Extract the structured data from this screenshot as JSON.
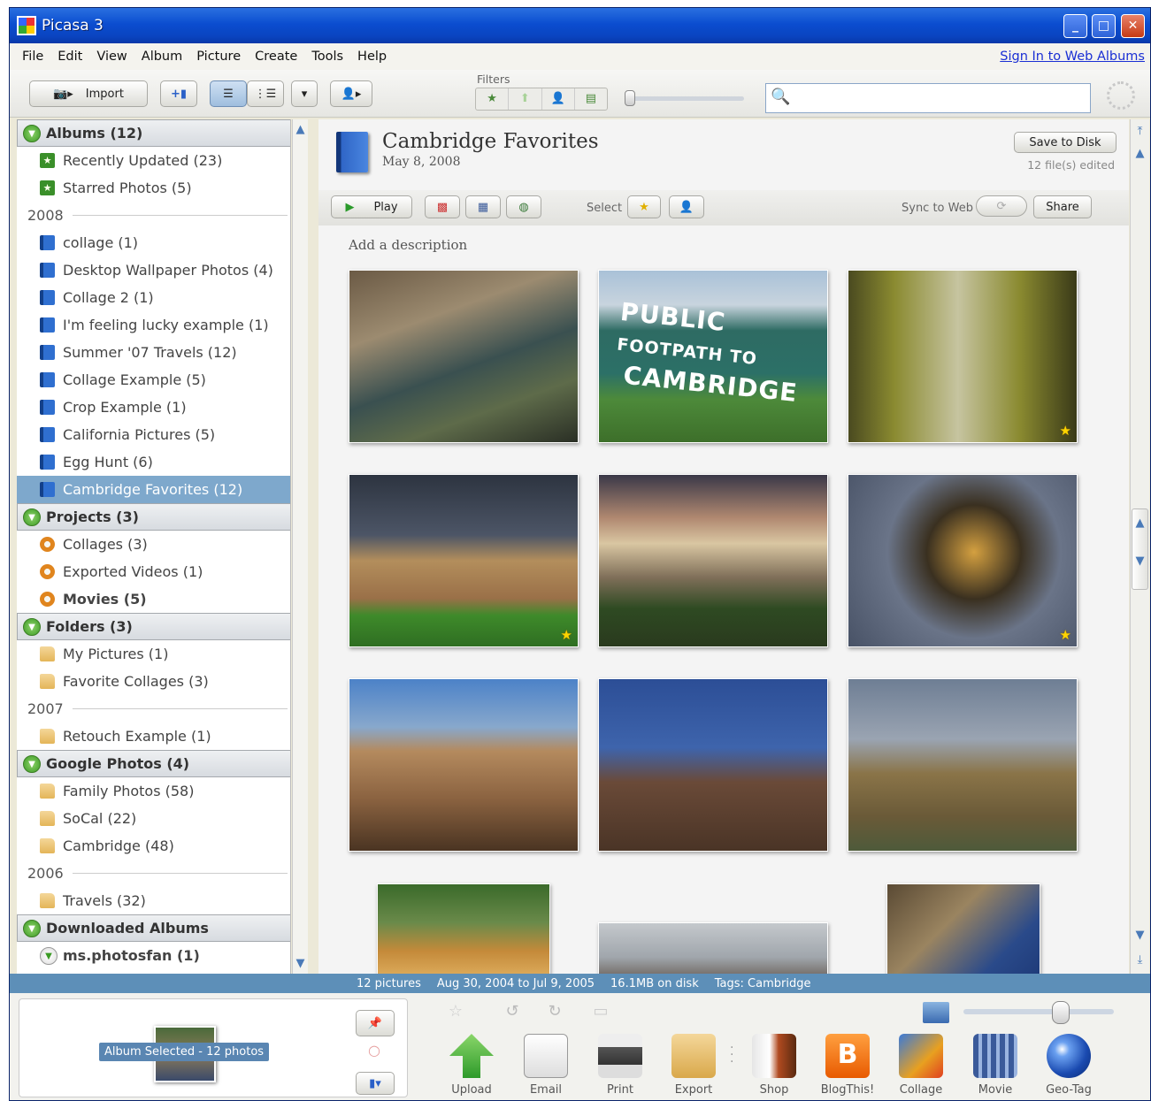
{
  "window": {
    "title": "Picasa 3"
  },
  "menu": [
    "File",
    "Edit",
    "View",
    "Album",
    "Picture",
    "Create",
    "Tools",
    "Help"
  ],
  "signin": "Sign In to Web Albums",
  "toolbar": {
    "import": "Import",
    "filters_label": "Filters",
    "search_placeholder": ""
  },
  "library": {
    "albums_header": "Albums (12)",
    "smart": [
      "Recently Updated (23)",
      "Starred Photos (5)"
    ],
    "year_2008": "2008",
    "albums": [
      "collage (1)",
      "Desktop Wallpaper Photos (4)",
      "Collage 2 (1)",
      "I'm feeling lucky example (1)",
      "Summer '07 Travels (12)",
      "Collage Example (5)",
      "Crop Example (1)",
      "California Pictures (5)",
      "Egg Hunt (6)",
      "Cambridge Favorites (12)"
    ],
    "projects_header": "Projects (3)",
    "projects": [
      "Collages (3)",
      "Exported Videos (1)",
      "Movies (5)"
    ],
    "folders_header": "Folders (3)",
    "folders": [
      "My Pictures (1)",
      "Favorite Collages (3)"
    ],
    "year_2007": "2007",
    "folders_2007": [
      "Retouch Example (1)"
    ],
    "google_header": "Google Photos (4)",
    "google": [
      "Family Photos (58)",
      "SoCal (22)",
      "Cambridge (48)"
    ],
    "year_2006": "2006",
    "google_2006": [
      "Travels (32)"
    ],
    "downloaded_header": "Downloaded Albums",
    "downloaded": [
      "ms.photosfan (1)"
    ]
  },
  "album": {
    "title": "Cambridge Favorites",
    "date": "May 8, 2008",
    "save": "Save to Disk",
    "edited": "12 file(s) edited",
    "play": "Play",
    "select": "Select",
    "sync": "Sync to Web",
    "share": "Share",
    "description": "Add a description"
  },
  "status": {
    "count": "12 pictures",
    "range": "Aug 30, 2004 to Jul 9, 2005",
    "size": "16.1MB on disk",
    "tags": "Tags: Cambridge"
  },
  "tray": {
    "label": "Album Selected - 12 photos"
  },
  "actions": [
    "Upload",
    "Email",
    "Print",
    "Export",
    "Shop",
    "BlogThis!",
    "Collage",
    "Movie",
    "Geo-Tag"
  ],
  "colors": {
    "selection": "#7ea8cc",
    "status": "#5d8fb8",
    "title": "#0b4dd0"
  }
}
